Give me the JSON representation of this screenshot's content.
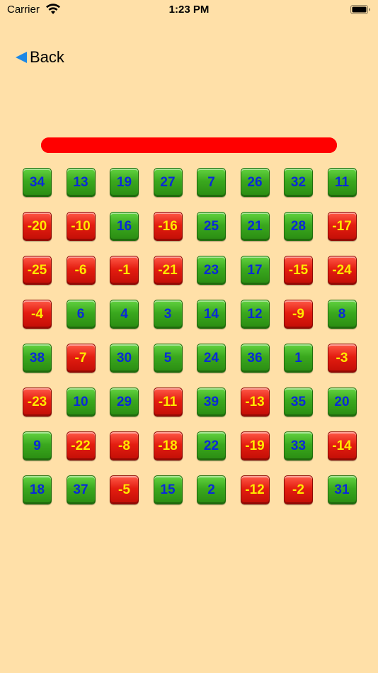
{
  "status_bar": {
    "carrier": "Carrier",
    "time": "1:23 PM",
    "wifi_icon": "wifi-icon",
    "battery_icon": "battery-icon"
  },
  "nav": {
    "back_label": "Back",
    "back_icon": "triangle-left-icon",
    "back_icon_color": "#1E88E5"
  },
  "progress": {
    "fraction": 1.0,
    "color": "#FF0000"
  },
  "colors": {
    "background": "#FFE0A8",
    "positive_tile": "#3AA81E",
    "positive_text": "#0A2AD8",
    "negative_tile": "#E41D10",
    "negative_text": "#FFE800"
  },
  "grid": {
    "rows": [
      [
        "34",
        "13",
        "19",
        "27",
        "7",
        "26",
        "32",
        "11"
      ],
      [
        "-20",
        "-10",
        "16",
        "-16",
        "25",
        "21",
        "28",
        "-17"
      ],
      [
        "-25",
        "-6",
        "-1",
        "-21",
        "23",
        "17",
        "-15",
        "-24"
      ],
      [
        "-4",
        "6",
        "4",
        "3",
        "14",
        "12",
        "-9",
        "8"
      ],
      [
        "38",
        "-7",
        "30",
        "5",
        "24",
        "36",
        "1",
        "-3"
      ],
      [
        "-23",
        "10",
        "29",
        "-11",
        "39",
        "-13",
        "35",
        "20"
      ],
      [
        "9",
        "-22",
        "-8",
        "-18",
        "22",
        "-19",
        "33",
        "-14"
      ],
      [
        "18",
        "37",
        "-5",
        "15",
        "2",
        "-12",
        "-2",
        "31"
      ]
    ]
  }
}
